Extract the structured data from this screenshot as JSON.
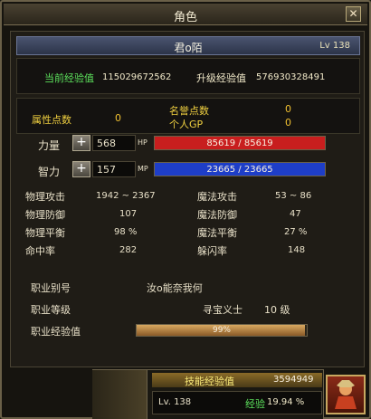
{
  "window": {
    "title": "角色",
    "close_label": "✕"
  },
  "character": {
    "name": "君o陌",
    "level": "Lv 138"
  },
  "experience": {
    "current_label": "当前经验值",
    "current_value": "115029672562",
    "next_label": "升级经验值",
    "next_value": "576930328491"
  },
  "points": {
    "attr_label": "属性点数",
    "attr_value": "0",
    "honor_label": "名誉点数",
    "honor_value": "0",
    "gp_label": "个人GP",
    "gp_value": "0"
  },
  "stats": [
    {
      "name": "力量",
      "value": "568",
      "bar_tag": "HP",
      "bar_text": "85619 / 85619",
      "fill": 1.0,
      "color": "#c81e1e"
    },
    {
      "name": "智力",
      "value": "157",
      "bar_tag": "MP",
      "bar_text": "23665 / 23665",
      "fill": 1.0,
      "color": "#1e3ec8"
    }
  ],
  "plus_label": "+",
  "combat": [
    {
      "left_label": "物理攻击",
      "left_value": "1942 ~ 2367",
      "right_label": "魔法攻击",
      "right_value": "53 ~ 86"
    },
    {
      "left_label": "物理防御",
      "left_value": "107",
      "right_label": "魔法防御",
      "right_value": "47"
    },
    {
      "left_label": "物理平衡",
      "left_value": "98 %",
      "right_label": "魔法平衡",
      "right_value": "27 %"
    },
    {
      "left_label": "命中率",
      "left_value": "282",
      "right_label": "躲闪率",
      "right_value": "148"
    }
  ],
  "job": {
    "alias_label": "职业别号",
    "alias_value": "汝o能奈我何",
    "level_label": "职业等级",
    "level_title": "寻宝义士",
    "level_value": "10 级",
    "exp_label": "职业经验值",
    "exp_text": "99%",
    "exp_fill": 0.99
  },
  "skill": {
    "header_label": "技能经验值",
    "header_value": "3594949",
    "level": "Lv. 138",
    "exp_label": "经验",
    "exp_value": "19.94 %"
  }
}
